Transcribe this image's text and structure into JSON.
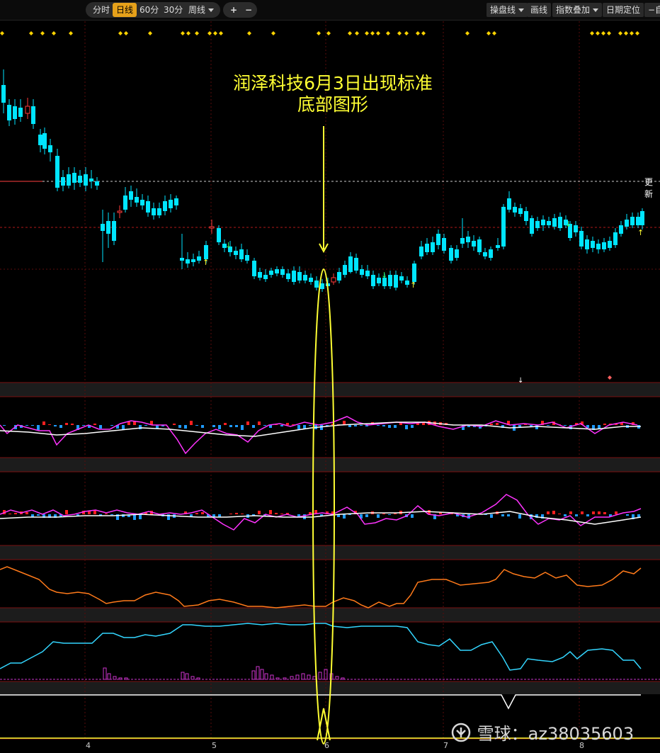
{
  "toolbar": {
    "period_buttons": [
      "分时",
      "日线",
      "60分",
      "30分",
      "周线"
    ],
    "active_period": "日线",
    "zoom_in": "+",
    "zoom_out": "−",
    "right_buttons": [
      "操盘线",
      "画线",
      "指数叠加",
      "日期定位"
    ],
    "right_edge": "−自"
  },
  "annotation": {
    "line1": "润泽科技6月3日出现标准",
    "line2": "底部图形"
  },
  "price_label": "更新",
  "x_axis_labels": [
    "4",
    "5",
    "6",
    "7",
    "8"
  ],
  "watermark": {
    "icon": "xueqiu-logo-icon",
    "text": "雪球：az38035603"
  },
  "colors": {
    "up": "#ff3a3a",
    "down": "#00e5ff",
    "highlight": "#ffff33",
    "grid": "#7a1010",
    "macd_dif": "#ff33ff",
    "macd_dea": "#ffffff",
    "orange_line": "#ff7a1a",
    "cyan_line": "#33d6ff"
  }
}
